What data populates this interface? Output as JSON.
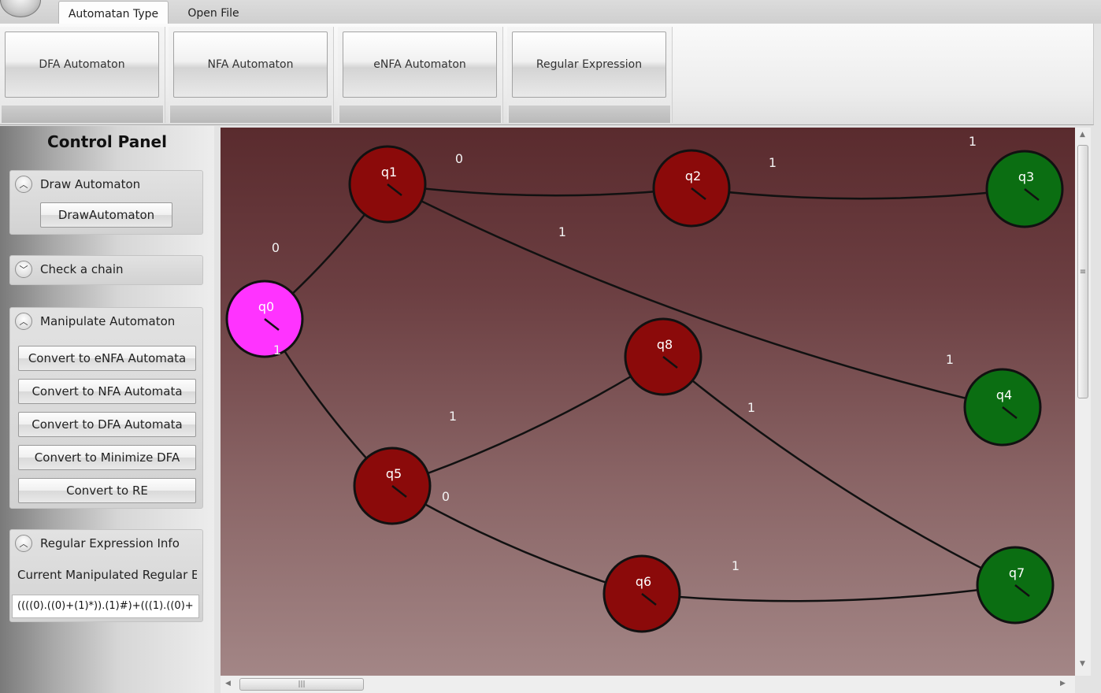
{
  "ribbon": {
    "tabs": [
      {
        "label": "Automatan Type",
        "active": true
      },
      {
        "label": "Open File",
        "active": false
      }
    ],
    "buttons": [
      {
        "label": "DFA Automaton"
      },
      {
        "label": "NFA Automaton"
      },
      {
        "label": "eNFA Automaton"
      },
      {
        "label": "Regular Expression"
      }
    ]
  },
  "control_panel": {
    "title": "Control Panel",
    "draw_section": {
      "title": "Draw Automaton",
      "button": "DrawAutomaton"
    },
    "check_section": {
      "title": "Check a chain"
    },
    "manipulate_section": {
      "title": "Manipulate Automaton",
      "buttons": [
        "Convert to eNFA Automata",
        "Convert to NFA Automata",
        "Convert to DFA Automata",
        "Convert to Minimize DFA",
        "Convert to RE"
      ]
    },
    "regex_section": {
      "title": "Regular Expression Info",
      "label": "Current Manipulated Regular E",
      "value": "((((0).((0)+(1)*)).(1)#)+(((1).((0)+"
    }
  },
  "automaton": {
    "colors": {
      "start": "#ff33ff",
      "normal": "#8b0a0a",
      "final": "#0b6e12"
    },
    "states": [
      {
        "id": "q0",
        "kind": "start"
      },
      {
        "id": "q1",
        "kind": "normal"
      },
      {
        "id": "q2",
        "kind": "normal"
      },
      {
        "id": "q3",
        "kind": "final"
      },
      {
        "id": "q4",
        "kind": "final"
      },
      {
        "id": "q5",
        "kind": "normal"
      },
      {
        "id": "q6",
        "kind": "normal"
      },
      {
        "id": "q7",
        "kind": "final"
      },
      {
        "id": "q8",
        "kind": "normal"
      }
    ],
    "transitions": [
      {
        "from": "q0",
        "to": "q1",
        "label": "0"
      },
      {
        "from": "q0",
        "to": "q5",
        "label": "1"
      },
      {
        "from": "q1",
        "to": "q2",
        "label": "0"
      },
      {
        "from": "q1",
        "to": "q4",
        "label": "1"
      },
      {
        "from": "q2",
        "to": "q3",
        "label": "1"
      },
      {
        "from": "q5",
        "to": "q8",
        "label": "1"
      },
      {
        "from": "q5",
        "to": "q6",
        "label": "0"
      },
      {
        "from": "q8",
        "to": "q7",
        "label": "1"
      },
      {
        "from": "q6",
        "to": "q7",
        "label": "1"
      }
    ],
    "floating_labels": [
      "1",
      "1"
    ]
  },
  "scrollbars": {
    "vertical_grip": "≡",
    "horizontal_grip": "|||"
  }
}
